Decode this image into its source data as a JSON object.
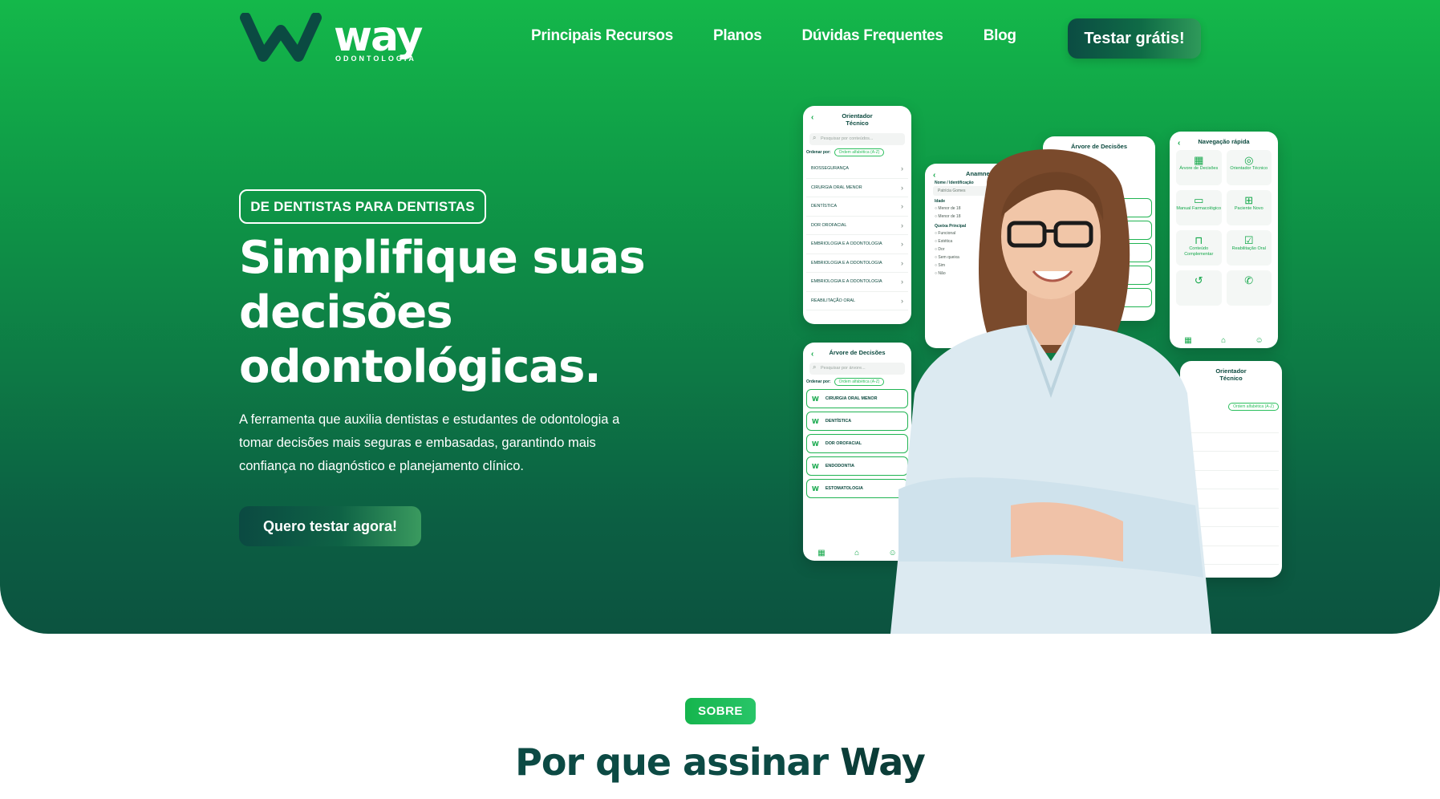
{
  "header": {
    "logo_word": "way",
    "logo_sub": "ODONTOLOGIA",
    "nav": [
      "Principais Recursos",
      "Planos",
      "Dúvidas Frequentes",
      "Blog"
    ],
    "cta": "Testar grátis!"
  },
  "hero": {
    "tag": "DE DENTISTAS PARA DENTISTAS",
    "headline_1": "Simplifique suas",
    "headline_2": "decisões",
    "headline_3": "odontológicas.",
    "lead": "A ferramenta que auxilia dentistas e estudantes de odontologia a tomar decisões mais seguras e embasadas, garantindo mais confiança no diagnóstico e planejamento clínico.",
    "cta": "Quero testar agora!"
  },
  "mock_orientador": {
    "title_1": "Orientador",
    "title_2": "Técnico",
    "search": "Pesquisar por conteúdos...",
    "sort_label": "Ordenar por:",
    "sort_value": "Ordem alfabética (A-Z)",
    "items": [
      "BIOSSEGURANÇA",
      "CIRURGIA ORAL MENOR",
      "DENTÍSTICA",
      "DOR OROFACIAL",
      "EMBRIOLOGIA E A ODONTOLOGIA",
      "EMBRIOLOGIA E A ODONTOLOGIA",
      "EMBRIOLOGIA E A ODONTOLOGIA",
      "REABILITAÇÃO ORAL"
    ]
  },
  "mock_arvore": {
    "title": "Árvore de Decisões",
    "search": "Pesquisar por árvore...",
    "sort_label": "Ordenar por:",
    "sort_value": "Ordem alfabética (A-Z)",
    "items": [
      "CIRURGIA ORAL MENOR",
      "DENTÍSTICA",
      "DOR OROFACIAL",
      "ENDODONTIA",
      "ESTOMATOLOGIA"
    ]
  },
  "mock_anamnese": {
    "title": "Anamnese",
    "name_label": "Nome / Identificação",
    "name_value": "Patrícia Gomes",
    "age_label": "Idade",
    "age_options": [
      "Menor de 18",
      "Menor de 18"
    ],
    "complaint_label": "Queixa Principal",
    "complaint_options": [
      "Funcional",
      "Estética",
      "Dor",
      "Sem queixa"
    ],
    "yesno": [
      "Sim",
      "Não"
    ]
  },
  "mock_navegacao": {
    "title": "Navegação rápida",
    "tiles": [
      "Árvore de Decisões",
      "Orientador Técnico",
      "Manual Farmacológico",
      "Paciente Novo",
      "Conteúdo Complementar",
      "Reabilitação Oral"
    ]
  },
  "mock_orientador2": {
    "title_1": "Orientador",
    "title_2": "Técnico",
    "sort_value": "Ordem alfabética (A-Z)"
  },
  "about": {
    "badge": "SOBRE",
    "title_prefix": "Por que assinar ",
    "title_brand": "Way"
  }
}
